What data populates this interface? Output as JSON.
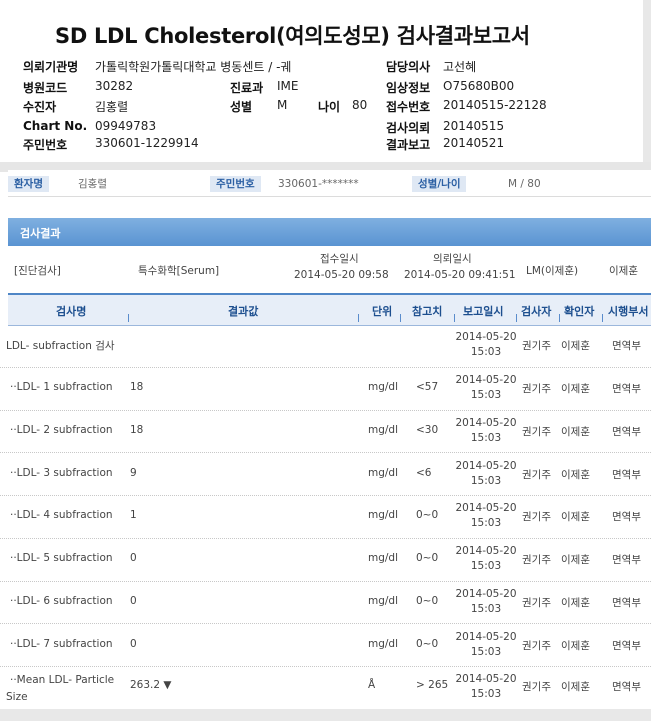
{
  "report": {
    "title": "SD LDL Cholesterol(여의도성모) 검사결과보고서"
  },
  "header": {
    "institution_label": "의뢰기관명",
    "institution_value": "가톨릭학원가톨릭대학교 병동센트 / -궤",
    "hospital_code_label": "병원코드",
    "hospital_code_value": "30282",
    "dept_label": "진료과",
    "dept_value": "IME",
    "patient_label": "수진자",
    "patient_value": "김홍렬",
    "sex_label": "성별",
    "sex_value": "M",
    "age_label": "나이",
    "age_value": "80",
    "chart_label": "Chart No.",
    "chart_value": "09949783",
    "rrn_label": "주민번호",
    "rrn_value": "330601-1229914",
    "doctor_label": "담당의사",
    "doctor_value": "고선혜",
    "clinical_label": "임상정보",
    "clinical_value": "O75680B00",
    "receipt_label": "접수번호",
    "receipt_value": "20140515-22128",
    "request_label": "검사의뢰",
    "request_value": "20140515",
    "report_label": "결과보고",
    "report_value": "20140521"
  },
  "patient_bar": {
    "name_tag": "환자명",
    "name_value": "김홍렬",
    "rrn_tag": "주민번호",
    "rrn_value": "330601-*******",
    "sexage_tag": "성별/나이",
    "sexage_value": "M / 80"
  },
  "panel": {
    "title": "검사결과"
  },
  "info": {
    "category": "[진단검사]",
    "specimen": "특수화학[Serum]",
    "receipt_title": "접수일시",
    "receipt_dt": "2014-05-20 09:58",
    "request_title": "의뢰일시",
    "request_dt": "2014-05-20 09:41:51",
    "lm": "LM(이제훈)",
    "confirmer": "이제훈"
  },
  "columns": {
    "name": "검사명",
    "result": "결과값",
    "unit": "단위",
    "ref": "참고치",
    "report_dt": "보고일시",
    "tester": "검사자",
    "confirmer": "확인자",
    "dept": "시행부서"
  },
  "rows": [
    {
      "name": "LDL- subfraction 검사",
      "name2": "",
      "result": "",
      "unit": "",
      "ref": "",
      "date": "2014-05-20",
      "time": "15:03",
      "tester": "권기주",
      "confirmer": "이제훈",
      "dept": "면역부"
    },
    {
      "name": "··LDL- 1 subfraction",
      "name2": "",
      "result": "18",
      "unit": "mg/dl",
      "ref": "<57",
      "date": "2014-05-20",
      "time": "15:03",
      "tester": "권기주",
      "confirmer": "이제훈",
      "dept": "면역부"
    },
    {
      "name": "··LDL- 2 subfraction",
      "name2": "",
      "result": "18",
      "unit": "mg/dl",
      "ref": "<30",
      "date": "2014-05-20",
      "time": "15:03",
      "tester": "권기주",
      "confirmer": "이제훈",
      "dept": "면역부"
    },
    {
      "name": "··LDL- 3 subfraction",
      "name2": "",
      "result": "9",
      "unit": "mg/dl",
      "ref": "<6",
      "date": "2014-05-20",
      "time": "15:03",
      "tester": "권기주",
      "confirmer": "이제훈",
      "dept": "면역부"
    },
    {
      "name": "··LDL- 4 subfraction",
      "name2": "",
      "result": "1",
      "unit": "mg/dl",
      "ref": "0~0",
      "date": "2014-05-20",
      "time": "15:03",
      "tester": "권기주",
      "confirmer": "이제훈",
      "dept": "면역부"
    },
    {
      "name": "··LDL- 5 subfraction",
      "name2": "",
      "result": "0",
      "unit": "mg/dl",
      "ref": "0~0",
      "date": "2014-05-20",
      "time": "15:03",
      "tester": "권기주",
      "confirmer": "이제훈",
      "dept": "면역부"
    },
    {
      "name": "··LDL- 6 subfraction",
      "name2": "",
      "result": "0",
      "unit": "mg/dl",
      "ref": "0~0",
      "date": "2014-05-20",
      "time": "15:03",
      "tester": "권기주",
      "confirmer": "이제훈",
      "dept": "면역부"
    },
    {
      "name": "··LDL- 7 subfraction",
      "name2": "",
      "result": "0",
      "unit": "mg/dl",
      "ref": "0~0",
      "date": "2014-05-20",
      "time": "15:03",
      "tester": "권기주",
      "confirmer": "이제훈",
      "dept": "면역부"
    },
    {
      "name": "··Mean LDL- Particle",
      "name2": "Size",
      "result": "263.2 ▼",
      "unit": "Å",
      "ref": "> 265",
      "date": "2014-05-20",
      "time": "15:03",
      "tester": "권기주",
      "confirmer": "이제훈",
      "dept": "면역부"
    }
  ]
}
